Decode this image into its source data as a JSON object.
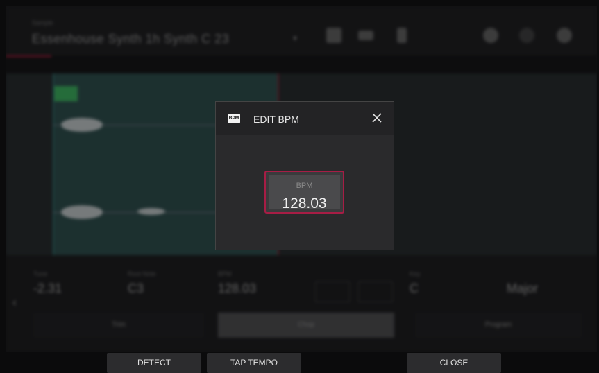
{
  "background": {
    "program": {
      "small_label": "Sample",
      "name": "Essenhouse Synth 1h Synth C 23"
    },
    "params": [
      {
        "label": "Tune",
        "value": "-2.31"
      },
      {
        "label": "Root Note",
        "value": "C3"
      },
      {
        "label": "BPM",
        "value": "128.03"
      },
      {
        "label": "Key",
        "value": "C"
      },
      {
        "label": "",
        "value": "Major"
      }
    ],
    "tabs": [
      "Trim",
      "Chop",
      "Program"
    ]
  },
  "dialog": {
    "icon_text": "BPM",
    "title": "EDIT BPM",
    "field_label": "BPM",
    "field_value": "128.03"
  },
  "footer": {
    "detect": "DETECT",
    "tap_tempo": "TAP TEMPO",
    "close": "CLOSE"
  },
  "colors": {
    "accent": "#a61d45",
    "dialog_bg": "#2a2a2c",
    "marker_green": "#3aa65a"
  }
}
